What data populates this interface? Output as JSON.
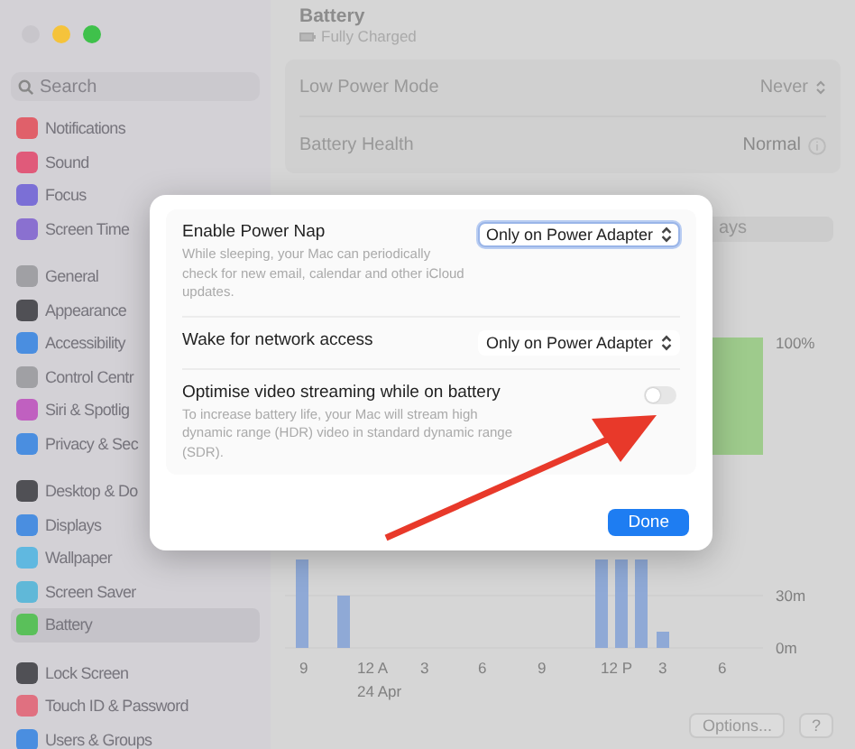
{
  "window": {
    "controls": [
      {
        "kind": "close"
      },
      {
        "kind": "minimize"
      },
      {
        "kind": "zoom"
      }
    ]
  },
  "sidebar": {
    "search": {
      "placeholder": "Search"
    },
    "groups": [
      [
        {
          "label": "Notifications",
          "color": "#e0606a",
          "selected": false
        },
        {
          "label": "Sound",
          "color": "#e05a7a",
          "selected": false
        },
        {
          "label": "Focus",
          "color": "#7b6fd6",
          "selected": false
        },
        {
          "label": "Screen Time",
          "color": "#8a70d0",
          "selected": false
        }
      ],
      [
        {
          "label": "General",
          "color": "#a0a0a4",
          "selected": false
        },
        {
          "label": "Appearance",
          "color": "#505055",
          "selected": false
        },
        {
          "label": "Accessibility",
          "color": "#4a8ee0",
          "selected": false
        },
        {
          "label": "Control Centr",
          "color": "#a0a0a4",
          "selected": false
        },
        {
          "label": "Siri & Spotlig",
          "color": "#c060c0",
          "selected": false
        },
        {
          "label": "Privacy & Sec",
          "color": "#4a8ee0",
          "selected": false
        }
      ],
      [
        {
          "label": "Desktop & Do",
          "color": "#505055",
          "selected": false
        },
        {
          "label": "Displays",
          "color": "#4a8ee0",
          "selected": false
        },
        {
          "label": "Wallpaper",
          "color": "#60b8e0",
          "selected": false
        },
        {
          "label": "Screen Saver",
          "color": "#60b8d8",
          "selected": false
        },
        {
          "label": "Battery",
          "color": "#5ac05a",
          "selected": true
        }
      ],
      [
        {
          "label": "Lock Screen",
          "color": "#505055",
          "selected": false
        },
        {
          "label": "Touch ID & Password",
          "color": "#e07080",
          "selected": false
        },
        {
          "label": "Users & Groups",
          "color": "#4a8ee0",
          "selected": false
        }
      ]
    ]
  },
  "header": {
    "title": "Battery",
    "status": "Fully Charged"
  },
  "settings": [
    {
      "label": "Low Power Mode",
      "value": "Never",
      "kind": "popup"
    },
    {
      "label": "Battery Health",
      "value": "Normal",
      "kind": "info"
    }
  ],
  "tabs": [
    {
      "label": "ays",
      "selected": false
    }
  ],
  "level_chart": {
    "y_labels": [
      "100%"
    ]
  },
  "usage_chart": {
    "x_labels": [
      "9",
      "12 A",
      "3",
      "6",
      "9",
      "12 P",
      "3",
      "6"
    ],
    "date": "24 Apr",
    "y_labels": [
      "30m",
      "0m"
    ]
  },
  "footer": {
    "buttons": [
      "Options...",
      "?"
    ]
  },
  "dialog": {
    "rows": [
      {
        "kind": "popup",
        "label": "Enable Power Nap",
        "description": "While sleeping, your Mac can periodically check for new email, calendar and other iCloud updates.",
        "value": "Only on Power Adapter",
        "focused": true
      },
      {
        "kind": "popup",
        "label": "Wake for network access",
        "value": "Only on Power Adapter",
        "focused": false
      },
      {
        "kind": "toggle",
        "label": "Optimise video streaming while on battery",
        "description": "To increase battery life, your Mac will stream high dynamic range (HDR) video in standard dynamic range (SDR).",
        "on": false
      }
    ],
    "button": "Done"
  }
}
